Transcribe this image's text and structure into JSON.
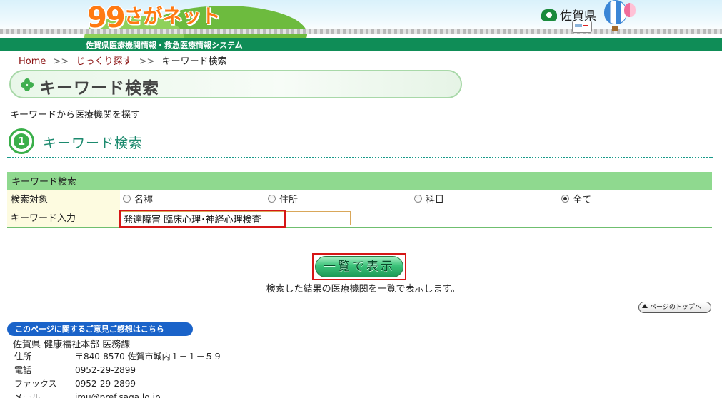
{
  "header": {
    "logo_number": "99",
    "logo_text": "さがネット",
    "prefecture_name": "佐賀県",
    "subtitle": "佐賀県医療機関情報・救急医療情報システム"
  },
  "breadcrumb": {
    "home": "Home",
    "separator_1": ">>",
    "level_2": "じっくり探す",
    "separator_2": ">>",
    "current": "キーワード検索"
  },
  "page": {
    "title": "キーワード検索",
    "description": "キーワードから医療機関を探す"
  },
  "section": {
    "step_number": "1",
    "heading": "キーワード検索"
  },
  "form": {
    "table_header": "キーワード検索",
    "search_target_label": "検索対象",
    "options": [
      {
        "label": "名称",
        "checked": false
      },
      {
        "label": "住所",
        "checked": false
      },
      {
        "label": "科目",
        "checked": false
      },
      {
        "label": "全て",
        "checked": true
      }
    ],
    "keyword_label": "キーワード入力",
    "keyword_value": "発達障害 臨床心理･神経心理検査"
  },
  "submit": {
    "label": "一覧で表示",
    "note": "検索した結果の医療機関を一覧で表示します。"
  },
  "page_top": "ページのトップへ",
  "footer": {
    "feedback_button": "このページに関するご意見ご感想はこちら",
    "department": "佐賀県  健康福祉本部  医務課",
    "contacts": [
      {
        "key": "住所",
        "value": "〒840-8570  佐賀市城内１－１－５９"
      },
      {
        "key": "電話",
        "value": "0952-29-2899"
      },
      {
        "key": "ファックス",
        "value": "0952-29-2899"
      },
      {
        "key": "メール",
        "value": "imu@pref.saga.lg.jp"
      }
    ]
  },
  "colors": {
    "header_bar": "#0f8d57",
    "table_header": "#8fd98f",
    "label_cell": "#fdfbe0",
    "highlight": "#d61616",
    "breadcrumb_link": "#8a1111",
    "section_heading": "#1c8a6e",
    "feedback_button": "#1a63c9"
  }
}
